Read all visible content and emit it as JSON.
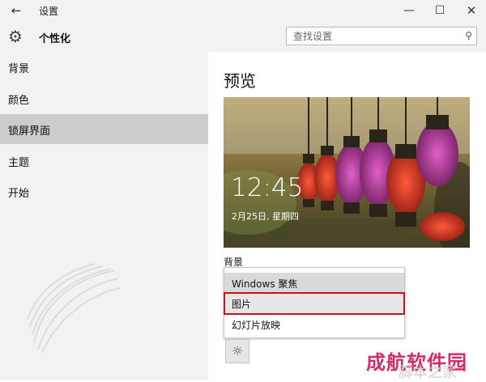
{
  "window": {
    "title": "设置",
    "back_icon": "back-arrow-icon",
    "min_icon": "minimize-icon",
    "max_icon": "maximize-icon",
    "close_icon": "close-icon"
  },
  "header": {
    "icon": "gear-icon",
    "title": "个性化"
  },
  "search": {
    "placeholder": "查找设置",
    "icon": "search-icon"
  },
  "sidebar": {
    "items": [
      {
        "label": "背景",
        "selected": false
      },
      {
        "label": "颜色",
        "selected": false
      },
      {
        "label": "锁屏界面",
        "selected": true
      },
      {
        "label": "主题",
        "selected": false
      },
      {
        "label": "开始",
        "selected": false
      }
    ]
  },
  "main": {
    "heading": "预览",
    "preview": {
      "time": "12:45",
      "date": "2月25日, 星期四"
    },
    "background_label": "背景",
    "dropdown_options": [
      {
        "label": "Windows 聚焦",
        "state": "current"
      },
      {
        "label": "图片",
        "state": "highlighted"
      },
      {
        "label": "幻灯片放映",
        "state": "normal"
      }
    ],
    "brightness_icon": "sun-icon"
  },
  "watermark": {
    "brand": "成航软件园",
    "overlay": "脚本之家"
  },
  "colors": {
    "selected_nav": "#cccccc",
    "highlight_border": "#c8111b",
    "sidebar_bg": "#f2f2f2",
    "watermark": "#d6296c"
  }
}
